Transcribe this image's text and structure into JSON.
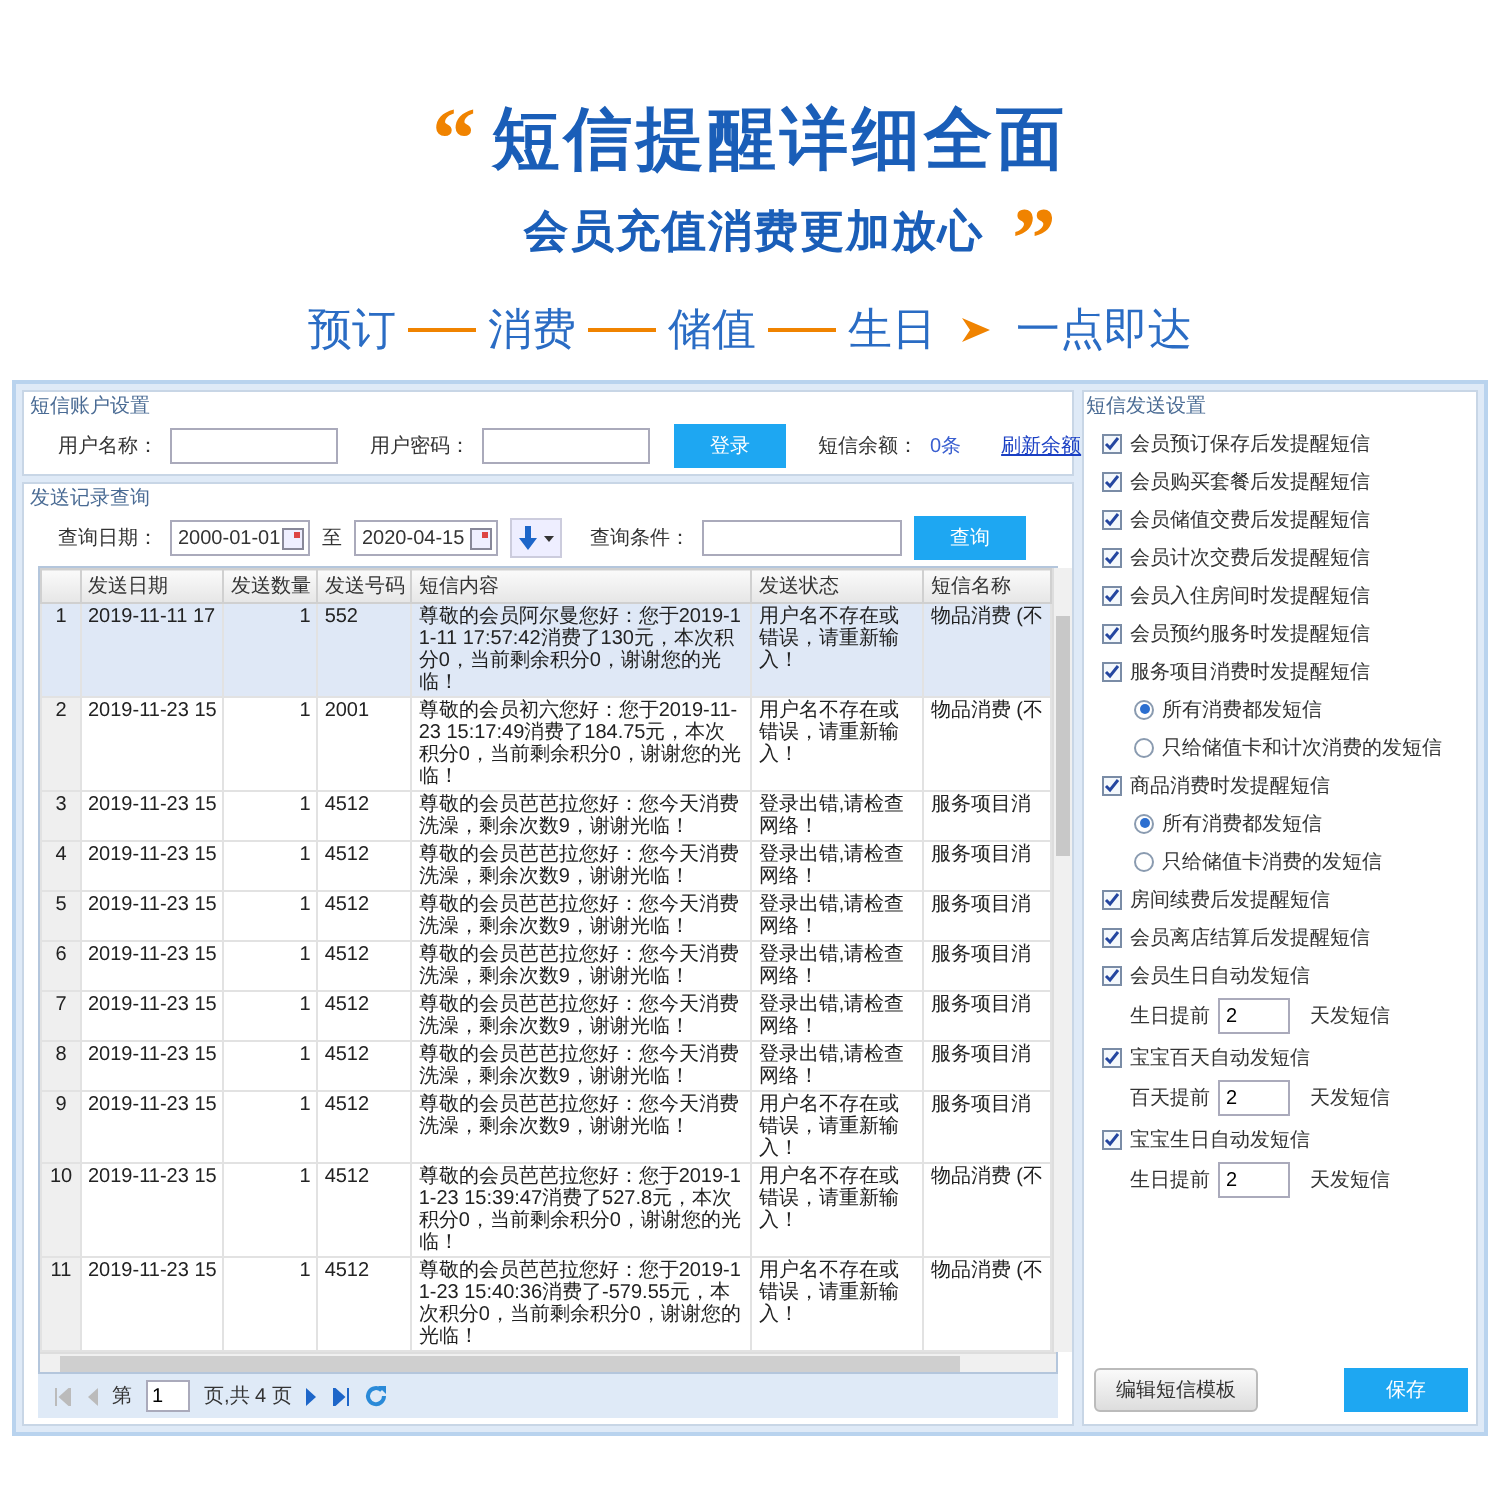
{
  "banner": {
    "open_quote": "“",
    "headline": "短信提醒详细全面",
    "subheadline": "会员充值消费更加放心",
    "close_quote": "”",
    "flow": [
      {
        "kind": "step",
        "label": "预订"
      },
      {
        "kind": "line"
      },
      {
        "kind": "step",
        "label": "消费"
      },
      {
        "kind": "line"
      },
      {
        "kind": "step",
        "label": "储值"
      },
      {
        "kind": "line"
      },
      {
        "kind": "step",
        "label": "生日"
      },
      {
        "kind": "arrow"
      },
      {
        "kind": "step",
        "label": "一点即达"
      }
    ]
  },
  "account": {
    "legend": "短信账户设置",
    "username_label": "用户名称：",
    "password_label": "用户密码：",
    "login_button": "登录",
    "balance_label": "短信余额：",
    "balance_value": "0条",
    "refresh_link": "刷新余额"
  },
  "query": {
    "legend": "发送记录查询",
    "date_label": "查询日期：",
    "date_from": "2000-01-01",
    "to_label": "至",
    "date_to": "2020-04-15",
    "condition_label": "查询条件：",
    "search_button": "查询"
  },
  "table": {
    "columns": [
      "发送日期",
      "发送数量",
      "发送号码",
      "短信内容",
      "发送状态",
      "短信名称"
    ],
    "rows": [
      {
        "index": "1",
        "date": "2019-11-11 17",
        "count": "1",
        "number": "552",
        "content": "尊敬的会员阿尔曼您好：您于2019-11-11 17:57:42消费了130元，本次积分0，当前剩余积分0，谢谢您的光临！",
        "status": "用户名不存在或错误，请重新输入！",
        "name": "物品消费 (不",
        "selected": true
      },
      {
        "index": "2",
        "date": "2019-11-23 15",
        "count": "1",
        "number": "2001",
        "content": "尊敬的会员初六您好：您于2019-11-23 15:17:49消费了184.75元，本次积分0，当前剩余积分0，谢谢您的光临！",
        "status": "用户名不存在或错误，请重新输入！",
        "name": "物品消费 (不",
        "selected": false
      },
      {
        "index": "3",
        "date": "2019-11-23 15",
        "count": "1",
        "number": "4512",
        "content": "尊敬的会员芭芭拉您好：您今天消费洗澡，剩余次数9，谢谢光临！",
        "status": "登录出错,请检查网络！",
        "name": "服务项目消",
        "selected": false
      },
      {
        "index": "4",
        "date": "2019-11-23 15",
        "count": "1",
        "number": "4512",
        "content": "尊敬的会员芭芭拉您好：您今天消费洗澡，剩余次数9，谢谢光临！",
        "status": "登录出错,请检查网络！",
        "name": "服务项目消",
        "selected": false
      },
      {
        "index": "5",
        "date": "2019-11-23 15",
        "count": "1",
        "number": "4512",
        "content": "尊敬的会员芭芭拉您好：您今天消费洗澡，剩余次数9，谢谢光临！",
        "status": "登录出错,请检查网络！",
        "name": "服务项目消",
        "selected": false
      },
      {
        "index": "6",
        "date": "2019-11-23 15",
        "count": "1",
        "number": "4512",
        "content": "尊敬的会员芭芭拉您好：您今天消费洗澡，剩余次数9，谢谢光临！",
        "status": "登录出错,请检查网络！",
        "name": "服务项目消",
        "selected": false
      },
      {
        "index": "7",
        "date": "2019-11-23 15",
        "count": "1",
        "number": "4512",
        "content": "尊敬的会员芭芭拉您好：您今天消费洗澡，剩余次数9，谢谢光临！",
        "status": "登录出错,请检查网络！",
        "name": "服务项目消",
        "selected": false
      },
      {
        "index": "8",
        "date": "2019-11-23 15",
        "count": "1",
        "number": "4512",
        "content": "尊敬的会员芭芭拉您好：您今天消费洗澡，剩余次数9，谢谢光临！",
        "status": "登录出错,请检查网络！",
        "name": "服务项目消",
        "selected": false
      },
      {
        "index": "9",
        "date": "2019-11-23 15",
        "count": "1",
        "number": "4512",
        "content": "尊敬的会员芭芭拉您好：您今天消费洗澡，剩余次数9，谢谢光临！",
        "status": "用户名不存在或错误，请重新输入！",
        "name": "服务项目消",
        "selected": false
      },
      {
        "index": "10",
        "date": "2019-11-23 15",
        "count": "1",
        "number": "4512",
        "content": "尊敬的会员芭芭拉您好：您于2019-11-23 15:39:47消费了527.8元，本次积分0，当前剩余积分0，谢谢您的光临！",
        "status": "用户名不存在或错误，请重新输入！",
        "name": "物品消费 (不",
        "selected": false
      },
      {
        "index": "11",
        "date": "2019-11-23 15",
        "count": "1",
        "number": "4512",
        "content": "尊敬的会员芭芭拉您好：您于2019-11-23 15:40:36消费了-579.55元，本次积分0，当前剩余积分0，谢谢您的光临！",
        "status": "用户名不存在或错误，请重新输入！",
        "name": "物品消费 (不",
        "selected": false
      }
    ]
  },
  "pager": {
    "page_label": "第",
    "page": "1",
    "total": "页,共 4 页"
  },
  "settings": {
    "legend": "短信发送设置",
    "items": [
      {
        "kind": "checkbox",
        "label": "会员预订保存后发提醒短信",
        "checked": true
      },
      {
        "kind": "checkbox",
        "label": "会员购买套餐后发提醒短信",
        "checked": true
      },
      {
        "kind": "checkbox",
        "label": "会员储值交费后发提醒短信",
        "checked": true
      },
      {
        "kind": "checkbox",
        "label": "会员计次交费后发提醒短信",
        "checked": true
      },
      {
        "kind": "checkbox",
        "label": "会员入住房间时发提醒短信",
        "checked": true
      },
      {
        "kind": "checkbox",
        "label": "会员预约服务时发提醒短信",
        "checked": true
      },
      {
        "kind": "checkbox",
        "label": "服务项目消费时发提醒短信",
        "checked": true
      },
      {
        "kind": "radio",
        "label": "所有消费都发短信",
        "selected": true
      },
      {
        "kind": "radio",
        "label": "只给储值卡和计次消费的发短信",
        "selected": false
      },
      {
        "kind": "checkbox",
        "label": "商品消费时发提醒短信",
        "checked": true
      },
      {
        "kind": "radio",
        "label": "所有消费都发短信",
        "selected": true
      },
      {
        "kind": "radio",
        "label": "只给储值卡消费的发短信",
        "selected": false
      },
      {
        "kind": "checkbox",
        "label": "房间续费后发提醒短信",
        "checked": true
      },
      {
        "kind": "checkbox",
        "label": "会员离店结算后发提醒短信",
        "checked": true
      },
      {
        "kind": "checkbox",
        "label": "会员生日自动发短信",
        "checked": true
      },
      {
        "kind": "number",
        "label": "生日提前",
        "value": "2",
        "suffix": "天发短信"
      },
      {
        "kind": "checkbox",
        "label": "宝宝百天自动发短信",
        "checked": true
      },
      {
        "kind": "number",
        "label": "百天提前",
        "value": "2",
        "suffix": "天发短信"
      },
      {
        "kind": "checkbox",
        "label": "宝宝生日自动发短信",
        "checked": true
      },
      {
        "kind": "number",
        "label": "生日提前",
        "value": "2",
        "suffix": "天发短信"
      }
    ],
    "template_button": "编辑短信模板",
    "save_button": "保存"
  }
}
